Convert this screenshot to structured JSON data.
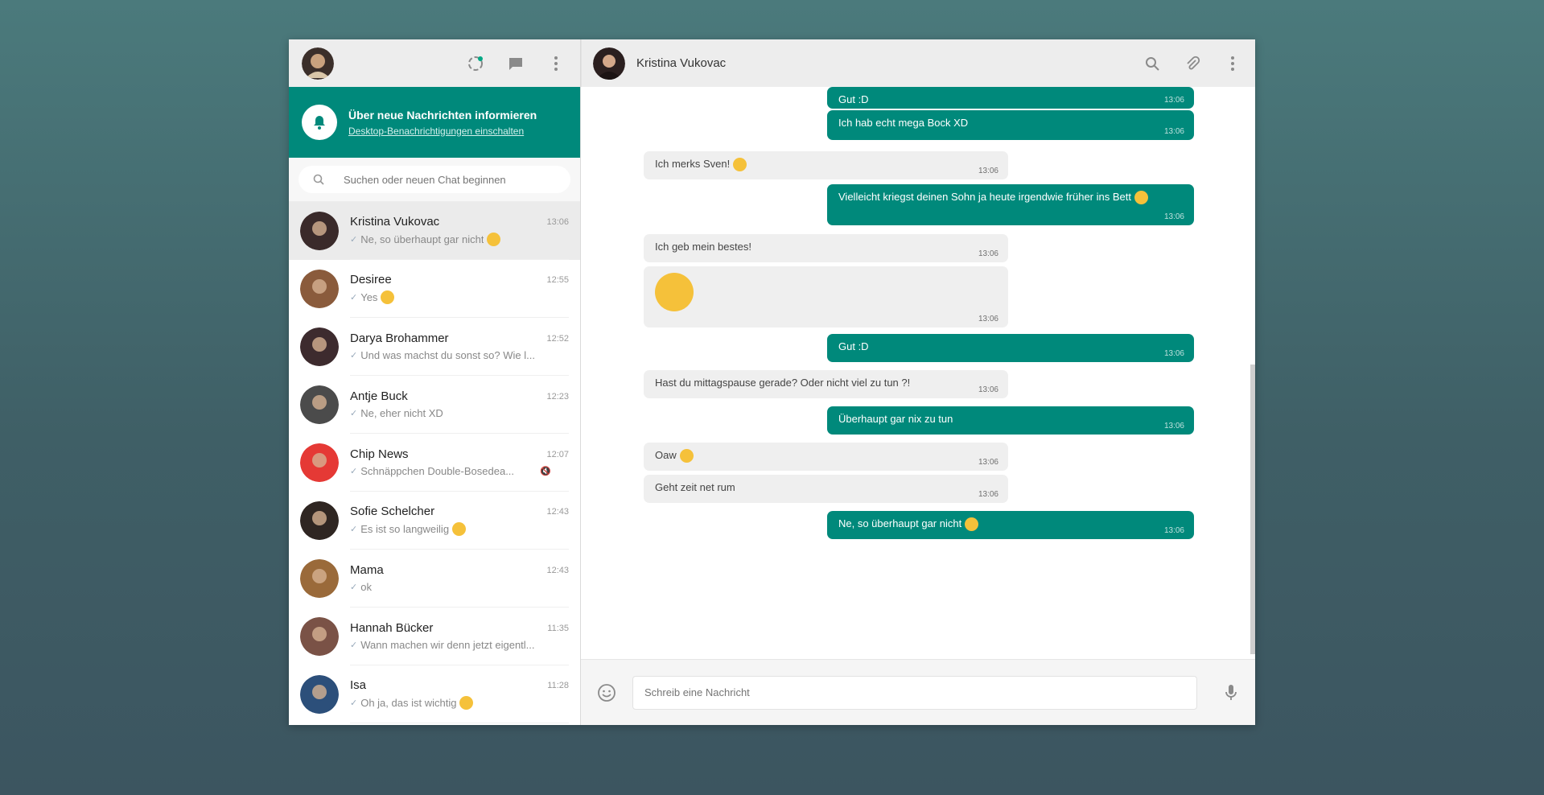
{
  "colors": {
    "accent": "#00897b",
    "header": "#ededed",
    "incoming": "#efefef",
    "emoji": "#f5c13a"
  },
  "sidebar": {
    "header_icons": [
      "status-icon",
      "new-chat-icon",
      "menu-icon"
    ],
    "notification": {
      "title": "Über neue Nachrichten informieren",
      "link": "Desktop-Benachrichtigungen einschalten"
    },
    "search": {
      "placeholder": "Suchen oder neuen Chat beginnen"
    },
    "chats": [
      {
        "name": "Kristina Vukovac",
        "time": "13:06",
        "preview": "Ne, so überhaupt gar nicht",
        "active": true,
        "avatar": "#3a2a2a"
      },
      {
        "name": "Desiree",
        "time": "12:55",
        "preview": "Yes",
        "avatar": "#8a5b3c"
      },
      {
        "name": "Darya Brohammer",
        "time": "12:52",
        "preview": "Und was machst du sonst so? Wie l...",
        "avatar": "#3d2b2e"
      },
      {
        "name": "Antje Buck",
        "time": "12:23",
        "preview": "Ne, eher nicht XD",
        "avatar": "#4b4b4b"
      },
      {
        "name": "Chip News",
        "time": "12:07",
        "preview": "Schnäppchen   Double-Bosedea...",
        "avatar": "#e53935"
      },
      {
        "name": "Sofie Schelcher",
        "time": "12:43",
        "preview": "Es ist so langweilig",
        "avatar": "#2f2622"
      },
      {
        "name": "Mama",
        "time": "12:43",
        "preview": "ok",
        "avatar": "#9a6a3a"
      },
      {
        "name": "Hannah Bücker",
        "time": "11:35",
        "preview": "Wann machen wir denn jetzt eigentl...",
        "avatar": "#7a5246"
      },
      {
        "name": "Isa",
        "time": "11:28",
        "preview": "Oh ja, das ist wichtig",
        "avatar": "#2c4f7a"
      }
    ]
  },
  "chat": {
    "contact_name": "Kristina Vukovac",
    "header_icons": [
      "search-icon",
      "attach-icon",
      "menu-icon"
    ],
    "messages": [
      {
        "dir": "out",
        "text": "Gut :D",
        "time": "13:06"
      },
      {
        "dir": "out",
        "text": "Ich hab echt mega Bock XD",
        "time": "13:06"
      },
      {
        "dir": "in",
        "text": "Ich merks Sven!",
        "time": "13:06"
      },
      {
        "dir": "out",
        "text": "Vielleicht kriegst deinen Sohn ja heute irgendwie früher ins Bett",
        "time": "13:06"
      },
      {
        "dir": "in",
        "text": "Ich geb mein bestes!",
        "time": "13:06"
      },
      {
        "dir": "in",
        "text": "",
        "time": "13:06"
      },
      {
        "dir": "out",
        "text": "Gut :D",
        "time": "13:06"
      },
      {
        "dir": "in",
        "text": "Hast du mittagspause gerade? Oder nicht viel zu tun ?!",
        "time": "13:06"
      },
      {
        "dir": "out",
        "text": "Überhaupt gar nix zu tun",
        "time": "13:06"
      },
      {
        "dir": "in",
        "text": "Oaw",
        "time": "13:06"
      },
      {
        "dir": "in",
        "text": "Geht zeit net rum",
        "time": "13:06"
      },
      {
        "dir": "out",
        "text": "Ne, so überhaupt gar nicht",
        "time": "13:06"
      }
    ],
    "composer": {
      "placeholder": "Schreib eine Nachricht"
    }
  }
}
